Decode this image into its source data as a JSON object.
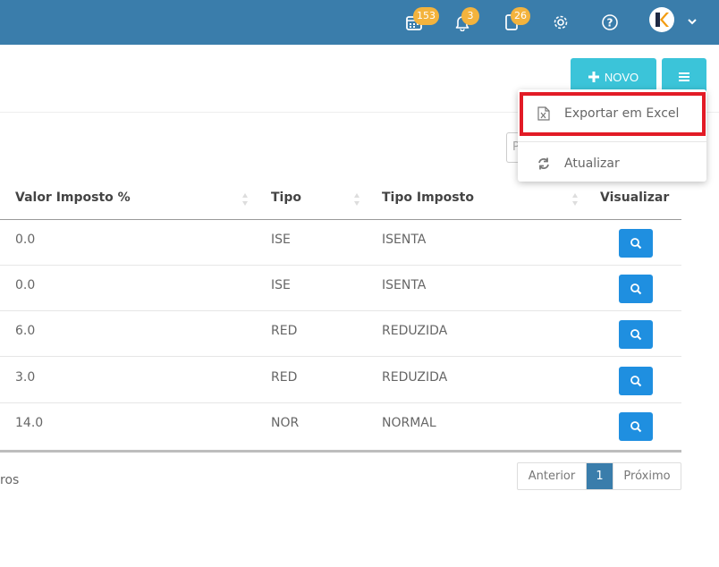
{
  "topbar": {
    "bg_color": "#3a7dab",
    "icons": [
      {
        "name": "calendar-icon",
        "badge": "153"
      },
      {
        "name": "bell-icon",
        "badge": "3"
      },
      {
        "name": "document-icon",
        "badge": "26"
      },
      {
        "name": "gear-icon",
        "badge": ""
      },
      {
        "name": "help-icon",
        "badge": ""
      }
    ],
    "avatar_letter": "K"
  },
  "toolbar": {
    "novo_label": "NOVO",
    "menu_icon": "hamburger-icon",
    "accent_color": "#3bc4d9"
  },
  "search": {
    "placeholder": "P"
  },
  "dropdown": {
    "items": [
      {
        "label": "Exportar em Excel",
        "icon": "excel-icon"
      },
      {
        "label": "Atualizar",
        "icon": "refresh-icon"
      }
    ],
    "highlight_color": "#e21b26"
  },
  "table": {
    "headers": [
      "Valor Imposto %",
      "Tipo",
      "Tipo Imposto",
      "Visualizar"
    ],
    "rows": [
      {
        "valor": "0.0",
        "tipo": "ISE",
        "tipo_imposto": "ISENTA"
      },
      {
        "valor": "0.0",
        "tipo": "ISE",
        "tipo_imposto": "ISENTA"
      },
      {
        "valor": "6.0",
        "tipo": "RED",
        "tipo_imposto": "REDUZIDA"
      },
      {
        "valor": "3.0",
        "tipo": "RED",
        "tipo_imposto": "REDUZIDA"
      },
      {
        "valor": "14.0",
        "tipo": "NOR",
        "tipo_imposto": "NORMAL"
      }
    ],
    "view_button_color": "#1f8fe0"
  },
  "footer": {
    "info_text": "ros",
    "pager": {
      "prev": "Anterior",
      "current": "1",
      "next": "Próximo"
    }
  }
}
